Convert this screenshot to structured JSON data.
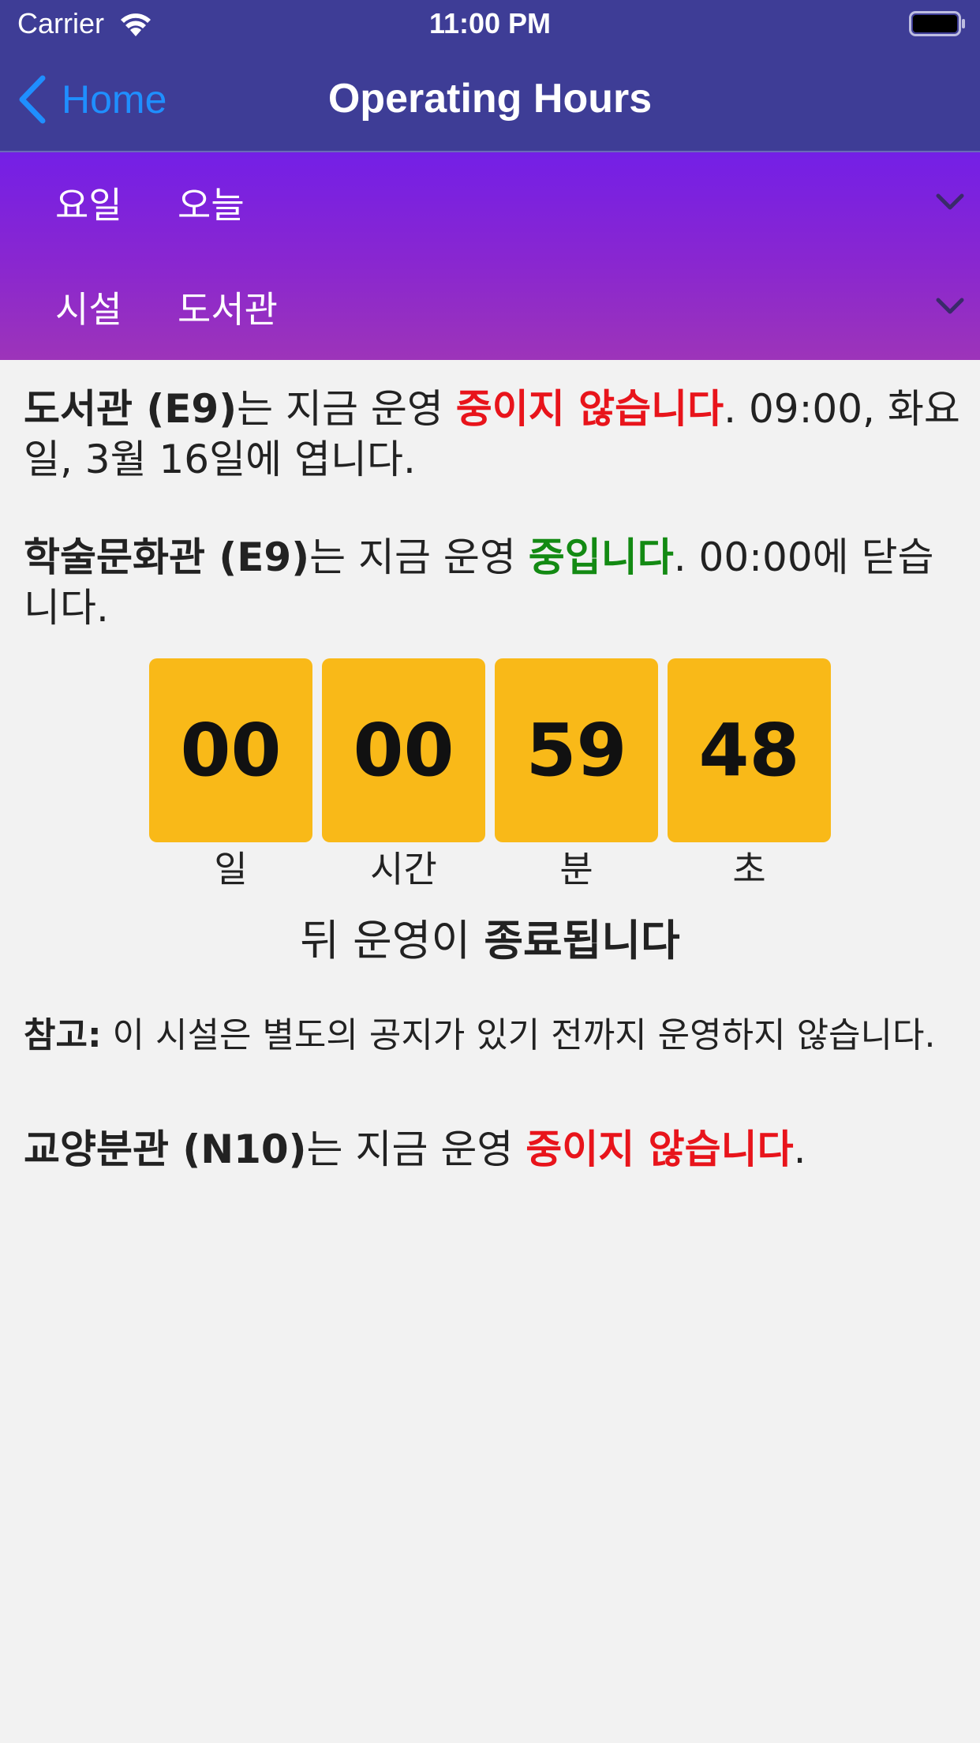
{
  "status_bar": {
    "carrier": "Carrier",
    "time": "11:00 PM",
    "wifi_icon": "wifi-icon",
    "battery_icon": "battery-icon"
  },
  "nav": {
    "back_label": "Home",
    "title": "Operating Hours",
    "back_icon": "chevron-left-icon",
    "color_bar": "#3e3d96",
    "color_back": "#1f8fff"
  },
  "filters": [
    {
      "label": "요일",
      "value": "오늘",
      "icon": "chevron-down-icon"
    },
    {
      "label": "시설",
      "value": "도서관",
      "icon": "chevron-down-icon"
    }
  ],
  "facilities": [
    {
      "name": "도서관 (E9)",
      "connector": "는 지금 운영 ",
      "status": "중이지 않습니다",
      "status_color": "#e8141b",
      "rest": ". 09:00, 화요일, 3월 16일에 엽니다."
    },
    {
      "name": "학술문화관 (E9)",
      "connector": "는 지금 운영 ",
      "status": "중입니다",
      "status_color": "#138a13",
      "rest": ". 00:00에 닫습니다."
    },
    {
      "name": "교양분관 (N10)",
      "connector": "는 지금 운영 ",
      "status": "중이지 않습니다",
      "status_color": "#e8141b",
      "rest": "."
    }
  ],
  "countdown": {
    "box_color": "#f9b918",
    "cells": [
      {
        "value": "00",
        "unit": "일"
      },
      {
        "value": "00",
        "unit": "시간"
      },
      {
        "value": "59",
        "unit": "분"
      },
      {
        "value": "48",
        "unit": "초"
      }
    ],
    "suffix_plain": "뒤 운영이 ",
    "suffix_bold": "종료됩니다"
  },
  "note": {
    "label": "참고:",
    "text": " 이 시설은 별도의 공지가 있기 전까지 운영하지 않습니다."
  }
}
